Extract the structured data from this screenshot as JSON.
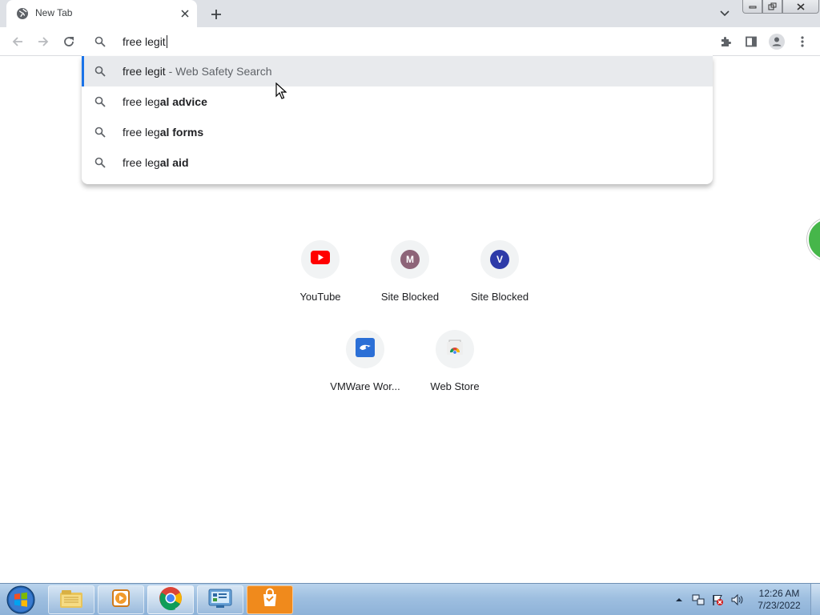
{
  "tab": {
    "title": "New Tab",
    "favicon": "globe-icon"
  },
  "omnibox": {
    "value": "free legit"
  },
  "suggestions": [
    {
      "typed": "free legit",
      "completion": "",
      "desc": " - Web Safety Search",
      "icon": "search-icon"
    },
    {
      "typed": "free leg",
      "completion": "al advice",
      "desc": "",
      "icon": "search-icon"
    },
    {
      "typed": "free leg",
      "completion": "al forms",
      "desc": "",
      "icon": "search-icon"
    },
    {
      "typed": "free leg",
      "completion": "al aid",
      "desc": "",
      "icon": "search-icon"
    }
  ],
  "shortcuts": [
    {
      "label": "YouTube",
      "icon": "youtube-icon"
    },
    {
      "label": "Site Blocked",
      "letter": "M",
      "color": "#8d6478"
    },
    {
      "label": "Site Blocked",
      "letter": "V",
      "color": "#2d3aa8"
    },
    {
      "label": "VMWare Wor...",
      "icon": "vmware-icon"
    },
    {
      "label": "Web Store",
      "icon": "webstore-icon"
    }
  ],
  "taskbar": {
    "items": [
      "explorer-icon",
      "media-player-icon",
      "chrome-icon",
      "control-panel-icon",
      "store-icon"
    ],
    "clock": {
      "time": "12:26 AM",
      "date": "7/23/2022"
    }
  },
  "colors": {
    "accent": "#1a73e8",
    "tabstrip": "#dee1e6",
    "youtube": "#ff0000"
  }
}
